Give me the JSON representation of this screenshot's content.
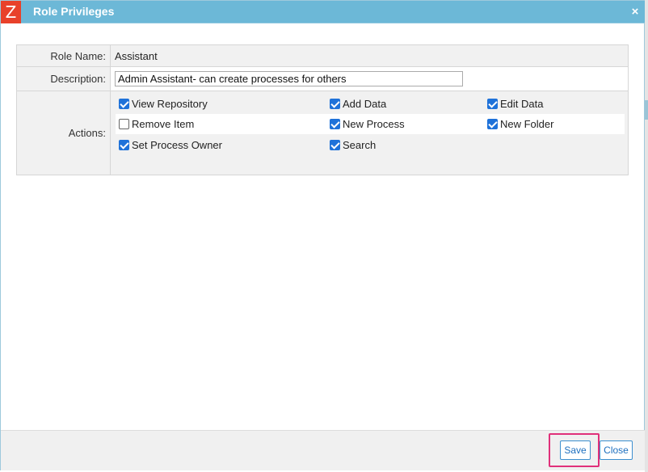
{
  "window": {
    "logo": "Z",
    "title": "Role Privileges",
    "close_glyph": "×"
  },
  "form": {
    "role_name_label": "Role Name:",
    "role_name_value": "Assistant",
    "description_label": "Description:",
    "description_value": "Admin Assistant- can create processes for others",
    "actions_label": "Actions:"
  },
  "actions": [
    {
      "label": "View Repository",
      "checked": true
    },
    {
      "label": "Add Data",
      "checked": true
    },
    {
      "label": "Edit Data",
      "checked": true
    },
    {
      "label": "Remove Item",
      "checked": false
    },
    {
      "label": "New Process",
      "checked": true
    },
    {
      "label": "New Folder",
      "checked": true
    },
    {
      "label": "Set Process Owner",
      "checked": true
    },
    {
      "label": "Search",
      "checked": true
    }
  ],
  "footer": {
    "save_label": "Save",
    "close_label": "Close"
  },
  "colors": {
    "titlebar": "#6cb8d7",
    "logo": "#e8412a",
    "checkbox": "#1f72d9",
    "button_text": "#1d6fbf",
    "highlight": "#e0307a"
  }
}
